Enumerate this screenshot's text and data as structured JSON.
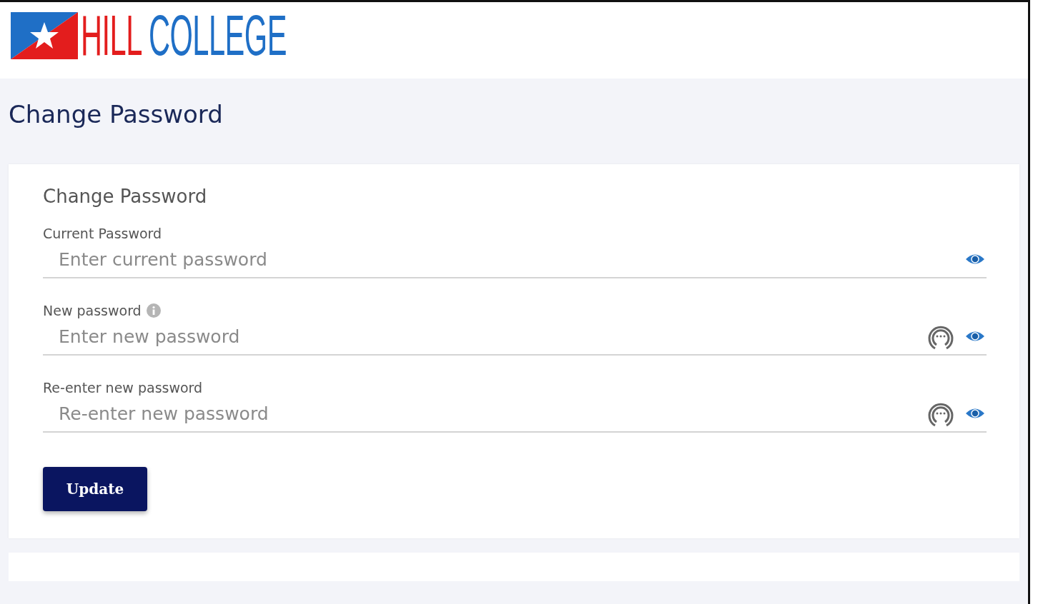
{
  "logo": {
    "word_1": "HILL",
    "word_2": "COLLEGE"
  },
  "page_title": "Change Password",
  "card": {
    "title": "Change Password",
    "fields": [
      {
        "label": "Current Password",
        "info": false,
        "placeholder": "Enter current password",
        "password_manager": false
      },
      {
        "label": "New password",
        "info": true,
        "placeholder": "Enter new password",
        "password_manager": true
      },
      {
        "label": "Re-enter new password",
        "info": false,
        "placeholder": "Re-enter new password",
        "password_manager": true
      }
    ],
    "button": "Update"
  }
}
